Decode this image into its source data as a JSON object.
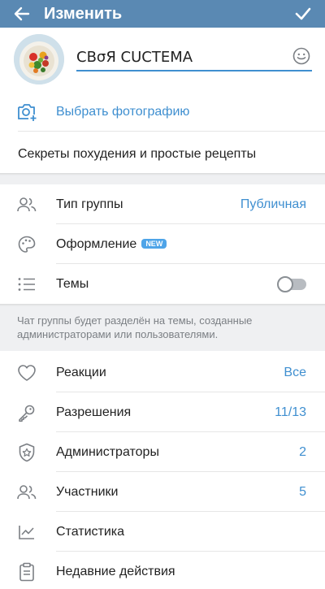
{
  "header": {
    "title": "Изменить",
    "back_icon": "arrow-left-icon",
    "confirm_icon": "checkmark-icon"
  },
  "profile": {
    "name_value": "CBσЯ CUCTEMA",
    "avatar": "group-avatar",
    "emoji_icon": "smiley-icon"
  },
  "photo": {
    "label": "Выбрать фотографию"
  },
  "description": {
    "text": "Секреты похудения и простые рецепты"
  },
  "settings": {
    "group_type": {
      "label": "Тип группы",
      "value": "Публичная"
    },
    "appearance": {
      "label": "Оформление",
      "badge": "NEW"
    },
    "topics": {
      "label": "Темы",
      "enabled": false
    }
  },
  "topics_note": "Чат группы будет разделён на темы, созданные администраторами или пользователями.",
  "manage": {
    "reactions": {
      "label": "Реакции",
      "value": "Все"
    },
    "permissions": {
      "label": "Разрешения",
      "value": "11/13"
    },
    "admins": {
      "label": "Администраторы",
      "value": "2"
    },
    "members": {
      "label": "Участники",
      "value": "5"
    },
    "stats": {
      "label": "Статистика"
    },
    "recent_actions": {
      "label": "Недавние действия"
    }
  },
  "colors": {
    "header_bg": "#5a89b3",
    "accent": "#3f8fd0",
    "section_gap": "#eff0f2",
    "badge": "#4ea4e8"
  }
}
